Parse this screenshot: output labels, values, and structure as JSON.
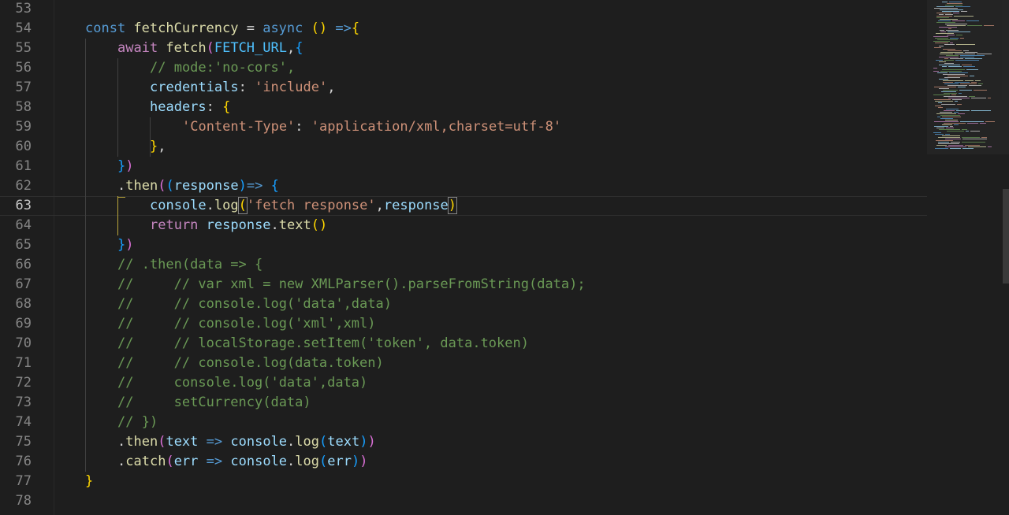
{
  "editor": {
    "theme_colors": {
      "background": "#1e1e1e",
      "keyword": "#569cd6",
      "control_keyword": "#c586c0",
      "function": "#dcdcaa",
      "variable": "#9cdcfe",
      "constant": "#4fc1ff",
      "string": "#ce9178",
      "comment": "#6a9955",
      "bracket_gold": "#ffd700",
      "bracket_orchid": "#da70d6",
      "bracket_blue": "#179fff"
    },
    "current_line": "63",
    "lines": [
      {
        "n": "53",
        "tokens": []
      },
      {
        "n": "54",
        "tokens": [
          [
            "kw",
            "const "
          ],
          [
            "fn",
            "fetchCurrency"
          ],
          [
            "pl",
            " = "
          ],
          [
            "kw",
            "async"
          ],
          [
            "pl",
            " "
          ],
          [
            "p1",
            "()"
          ],
          [
            "pl",
            " "
          ],
          [
            "kw",
            "=>"
          ],
          [
            "p1",
            "{"
          ]
        ]
      },
      {
        "n": "55",
        "tokens": [
          [
            "kw2",
            "await "
          ],
          [
            "fn",
            "fetch"
          ],
          [
            "p2",
            "("
          ],
          [
            "const",
            "FETCH_URL"
          ],
          [
            "pl",
            ","
          ],
          [
            "p3",
            "{"
          ]
        ]
      },
      {
        "n": "56",
        "tokens": [
          [
            "cm",
            "// mode:'no-cors',"
          ]
        ]
      },
      {
        "n": "57",
        "tokens": [
          [
            "var",
            "credentials"
          ],
          [
            "pl",
            ": "
          ],
          [
            "str",
            "'include'"
          ],
          [
            "pl",
            ","
          ]
        ]
      },
      {
        "n": "58",
        "tokens": [
          [
            "var",
            "headers"
          ],
          [
            "pl",
            ": "
          ],
          [
            "p1",
            "{"
          ]
        ]
      },
      {
        "n": "59",
        "tokens": [
          [
            "str",
            "'Content-Type'"
          ],
          [
            "pl",
            ": "
          ],
          [
            "str",
            "'application/xml,charset=utf-8'"
          ]
        ]
      },
      {
        "n": "60",
        "tokens": [
          [
            "p1",
            "}"
          ],
          [
            "pl",
            ","
          ]
        ]
      },
      {
        "n": "61",
        "tokens": [
          [
            "p3",
            "}"
          ],
          [
            "p2",
            ")"
          ]
        ]
      },
      {
        "n": "62",
        "tokens": [
          [
            "pl",
            "."
          ],
          [
            "fn",
            "then"
          ],
          [
            "p2",
            "("
          ],
          [
            "p3",
            "("
          ],
          [
            "var",
            "response"
          ],
          [
            "p3",
            ")"
          ],
          [
            "kw",
            "=>"
          ],
          [
            "pl",
            " "
          ],
          [
            "p3",
            "{"
          ]
        ]
      },
      {
        "n": "63",
        "tokens": [
          [
            "var",
            "console"
          ],
          [
            "pl",
            "."
          ],
          [
            "fn",
            "log"
          ],
          [
            "p1bm",
            "("
          ],
          [
            "str",
            "'fetch response'"
          ],
          [
            "pl",
            ","
          ],
          [
            "var",
            "response"
          ],
          [
            "p1bm",
            ")"
          ]
        ]
      },
      {
        "n": "64",
        "tokens": [
          [
            "kw2",
            "return "
          ],
          [
            "var",
            "response"
          ],
          [
            "pl",
            "."
          ],
          [
            "fn",
            "text"
          ],
          [
            "p1",
            "()"
          ]
        ]
      },
      {
        "n": "65",
        "tokens": [
          [
            "p3",
            "}"
          ],
          [
            "p2",
            ")"
          ]
        ]
      },
      {
        "n": "66",
        "tokens": [
          [
            "cm",
            "// .then(data => {"
          ]
        ]
      },
      {
        "n": "67",
        "tokens": [
          [
            "cm",
            "//     // var xml = new XMLParser().parseFromString(data);"
          ]
        ]
      },
      {
        "n": "68",
        "tokens": [
          [
            "cm",
            "//     // console.log('data',data)"
          ]
        ]
      },
      {
        "n": "69",
        "tokens": [
          [
            "cm",
            "//     // console.log('xml',xml)"
          ]
        ]
      },
      {
        "n": "70",
        "tokens": [
          [
            "cm",
            "//     // localStorage.setItem('token', data.token)"
          ]
        ]
      },
      {
        "n": "71",
        "tokens": [
          [
            "cm",
            "//     // console.log(data.token)"
          ]
        ]
      },
      {
        "n": "72",
        "tokens": [
          [
            "cm",
            "//     console.log('data',data)"
          ]
        ]
      },
      {
        "n": "73",
        "tokens": [
          [
            "cm",
            "//     setCurrency(data)"
          ]
        ]
      },
      {
        "n": "74",
        "tokens": [
          [
            "cm",
            "// })"
          ]
        ]
      },
      {
        "n": "75",
        "tokens": [
          [
            "pl",
            "."
          ],
          [
            "fn",
            "then"
          ],
          [
            "p2",
            "("
          ],
          [
            "var",
            "text"
          ],
          [
            "pl",
            " "
          ],
          [
            "kw",
            "=>"
          ],
          [
            "pl",
            " "
          ],
          [
            "var",
            "console"
          ],
          [
            "pl",
            "."
          ],
          [
            "fn",
            "log"
          ],
          [
            "p3",
            "("
          ],
          [
            "var",
            "text"
          ],
          [
            "p3",
            ")"
          ],
          [
            "p2",
            ")"
          ]
        ]
      },
      {
        "n": "76",
        "tokens": [
          [
            "pl",
            "."
          ],
          [
            "fn",
            "catch"
          ],
          [
            "p2",
            "("
          ],
          [
            "var",
            "err"
          ],
          [
            "pl",
            " "
          ],
          [
            "kw",
            "=>"
          ],
          [
            "pl",
            " "
          ],
          [
            "var",
            "console"
          ],
          [
            "pl",
            "."
          ],
          [
            "fn",
            "log"
          ],
          [
            "p3",
            "("
          ],
          [
            "var",
            "err"
          ],
          [
            "p3",
            ")"
          ],
          [
            "p2",
            ")"
          ]
        ]
      },
      {
        "n": "77",
        "tokens": [
          [
            "p1",
            "}"
          ]
        ]
      },
      {
        "n": "78",
        "tokens": []
      }
    ]
  }
}
